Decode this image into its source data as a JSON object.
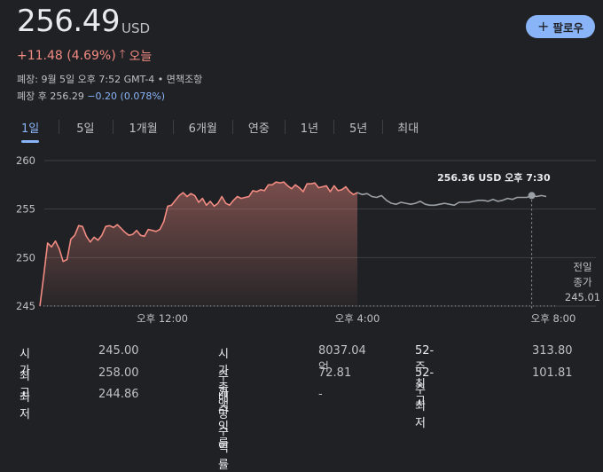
{
  "header": {
    "price": "256.49",
    "currency": "USD",
    "follow_label": "팔로우",
    "change": "+11.48 (4.69%)",
    "change_period": "오늘",
    "close_info": "폐장: 9월 5일 오후 7:52 GMT-4 • 면책조항",
    "after_hours_prefix": "폐장 후 256.29 ",
    "after_hours_change": "−0.20 (0.078%)"
  },
  "tabs": [
    "1일",
    "5일",
    "1개월",
    "6개월",
    "연중",
    "1년",
    "5년",
    "최대"
  ],
  "active_tab": 0,
  "chart_data": {
    "type": "line",
    "ylim": [
      245,
      260
    ],
    "yticks": [
      "260",
      "255",
      "250",
      "245"
    ],
    "xticks": [
      "오후 12:00",
      "오후 4:00",
      "오후 8:00"
    ],
    "previous_close_label": [
      "전일",
      "종가"
    ],
    "previous_close_value": "245.01",
    "previous_close": 245.01,
    "tooltip_value": "256.36 USD",
    "tooltip_time": "오후 7:30",
    "regular_session": [
      245.0,
      248.2,
      251.5,
      251.1,
      251.7,
      250.9,
      249.6,
      249.8,
      251.9,
      252.3,
      253.3,
      253.2,
      252.2,
      251.6,
      252.1,
      251.8,
      252.3,
      253.2,
      253.3,
      253.1,
      253.4,
      253.0,
      252.6,
      252.3,
      252.4,
      252.8,
      252.3,
      252.2,
      252.9,
      252.8,
      252.7,
      252.9,
      253.7,
      255.3,
      255.4,
      255.9,
      256.4,
      256.7,
      256.3,
      256.6,
      256.4,
      255.7,
      256.1,
      255.4,
      255.8,
      255.3,
      255.6,
      256.3,
      255.6,
      255.4,
      255.9,
      256.3,
      256.1,
      256.2,
      256.3,
      256.9,
      256.8,
      257.0,
      256.9,
      257.5,
      257.5,
      257.8,
      257.7,
      257.8,
      257.4,
      257.1,
      257.5,
      257.2,
      256.8,
      257.6,
      257.6,
      257.7,
      257.2,
      257.3,
      257.4,
      256.8,
      257.4,
      256.9,
      257.0,
      257.3,
      256.8,
      256.5,
      256.7
    ],
    "after_hours": [
      256.7,
      256.5,
      256.6,
      256.3,
      256.2,
      256.4,
      255.9,
      255.6,
      255.5,
      255.7,
      255.6,
      255.5,
      255.6,
      255.8,
      255.5,
      255.4,
      255.4,
      255.5,
      255.6,
      255.5,
      255.4,
      255.7,
      255.7,
      255.7,
      255.8,
      255.9,
      255.9,
      255.8,
      256.0,
      255.8,
      255.9,
      256.1,
      256.0,
      256.2,
      256.2,
      256.2,
      256.4,
      256.3,
      256.4,
      256.3
    ]
  },
  "stats": [
    {
      "label": "시가",
      "value": "245.00"
    },
    {
      "label": "최고",
      "value": "258.00"
    },
    {
      "label": "최저",
      "value": "244.86"
    },
    {
      "label": "시가총액",
      "value": "8037.04억"
    },
    {
      "label": "주가수익률",
      "value": "72.81"
    },
    {
      "label": "배당수익률",
      "value": "-"
    },
    {
      "label": "52-주 최고",
      "value": "313.80"
    },
    {
      "label": "52-주 최저",
      "value": "101.81"
    }
  ],
  "colors": {
    "background": "#202124",
    "accent": "#8ab4f8",
    "up": "#f28b82",
    "line_regular": "#f28b82",
    "line_after": "#9aa0a6",
    "grid": "#3c4043"
  }
}
